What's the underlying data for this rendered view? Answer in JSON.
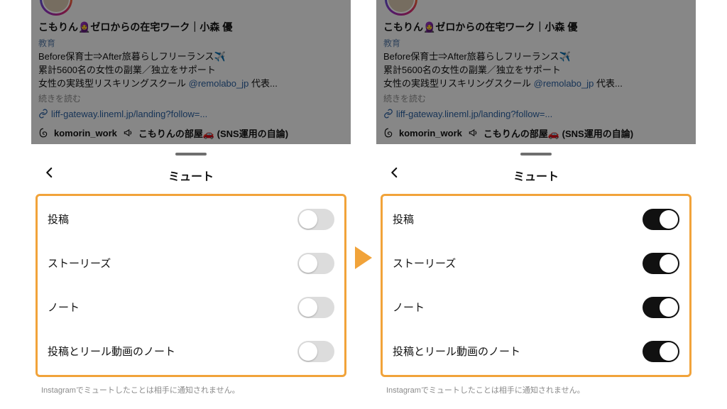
{
  "profile": {
    "display_name": "こもりん🧕ゼロからの在宅ワーク｜小森 優",
    "category": "教育",
    "bio_line1": "Before保育士⇒After旅暮らしフリーランス✈️",
    "bio_line2": "累計5600名の女性の副業／独立をサポート",
    "bio_line3_prefix": "女性の実践型リスキリングスクール ",
    "bio_line3_mention": "@remolabo_jp",
    "bio_line3_suffix": " 代表...",
    "read_more": "続きを読む",
    "external_link": "liff-gateway.lineml.jp/landing?follow=...",
    "threads_handle": "komorin_work",
    "channel_label": "こもりんの部屋🚗 (SNS運用の自論)"
  },
  "sheet": {
    "title": "ミュート",
    "rows": {
      "posts": "投稿",
      "stories": "ストーリーズ",
      "notes": "ノート",
      "posts_reels_notes": "投稿とリール動画のノート"
    },
    "footnote": "Instagramでミュートしたことは相手に通知されません。"
  }
}
